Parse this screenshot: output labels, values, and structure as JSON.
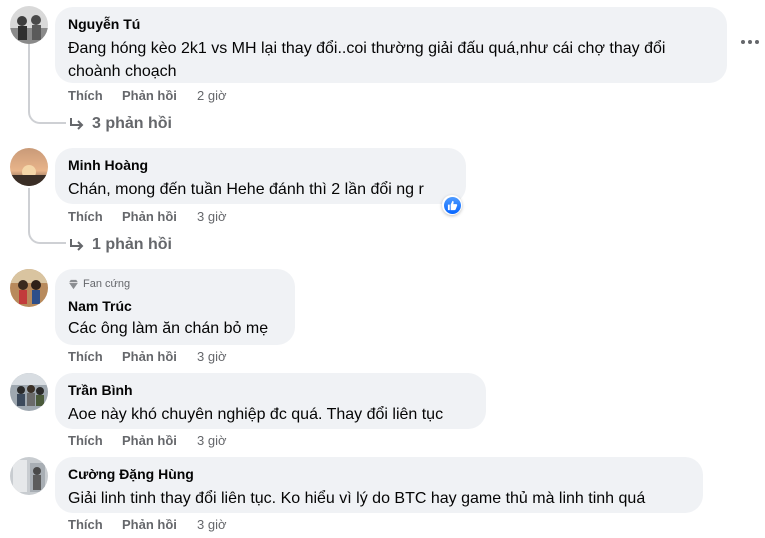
{
  "comments": [
    {
      "author": "Nguyễn Tú",
      "text_line1": "Đang hóng kèo 2k1 vs MH lại thay đổi..coi thường giải đấu quá,như cái chợ thay đổi",
      "text_line2": "choành choạch",
      "like_label": "Thích",
      "reply_label": "Phản hồi",
      "time": "2 giờ",
      "replies": "3 phản hồi"
    },
    {
      "author": "Minh Hoàng",
      "text_line1": "Chán, mong đến tuần Hehe đánh thì 2 lần đổi ng r",
      "like_label": "Thích",
      "reply_label": "Phản hồi",
      "time": "3 giờ",
      "replies": "1 phản hồi"
    },
    {
      "badge": "Fan cứng",
      "author": "Nam Trúc",
      "text_line1": "Các ông làm ăn chán bỏ mẹ",
      "like_label": "Thích",
      "reply_label": "Phản hồi",
      "time": "3 giờ"
    },
    {
      "author": "Trần Bình",
      "text_line1": "Aoe này khó chuyên nghiệp đc quá. Thay đổi liên tục",
      "like_label": "Thích",
      "reply_label": "Phản hồi",
      "time": "3 giờ"
    },
    {
      "author": "Cường Đặng Hùng",
      "text_line1": "Giải linh tinh thay đổi liên tục. Ko hiểu vì lý do BTC hay game thủ mà linh tinh quá",
      "like_label": "Thích",
      "reply_label": "Phản hồi",
      "time": "3 giờ"
    }
  ],
  "icons": {
    "more": "more-options-icon",
    "reply_arrow": "reply-arrow-icon",
    "like_reaction": "like-reaction-icon",
    "fan_badge": "diamond-icon"
  },
  "colors": {
    "bubble": "#f0f2f5",
    "secondary_text": "#65676b",
    "like_blue": "#0866ff"
  }
}
